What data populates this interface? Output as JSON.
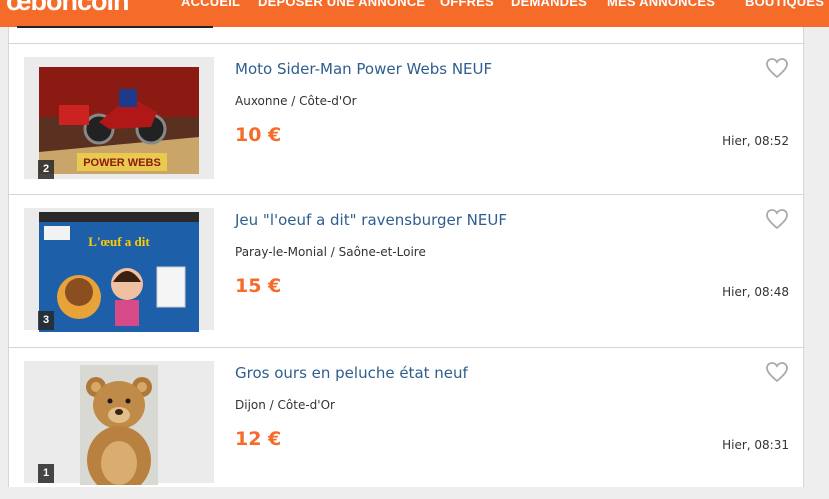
{
  "header": {
    "logo": "œboncoin",
    "nav": [
      "ACCUEIL",
      "DÉPOSER UNE ANNONCE",
      "OFFRES",
      "DEMANDES",
      "MES ANNONCES",
      "BOUTIQUES"
    ]
  },
  "colors": {
    "brand": "#f56b2a",
    "title_link": "#2e5e8e"
  },
  "listings": [
    {
      "title": "Moto Sider-Man Power Webs NEUF",
      "location": "Auxonne / Côte-d'Or",
      "price": "10 €",
      "date": "Hier, 08:52",
      "photo_count": "2",
      "photo_text": "POWER WEBS",
      "favorite_icon": "heart-outline-icon"
    },
    {
      "title": "Jeu \"l'oeuf a dit\" ravensburger NEUF",
      "location": "Paray-le-Monial / Saône-et-Loire",
      "price": "15 €",
      "date": "Hier, 08:48",
      "photo_count": "3",
      "photo_text": "L'œuf a dit",
      "favorite_icon": "heart-outline-icon"
    },
    {
      "title": "Gros ours en peluche état neuf",
      "location": "Dijon / Côte-d'Or",
      "price": "12 €",
      "date": "Hier, 08:31",
      "photo_count": "1",
      "favorite_icon": "heart-outline-icon"
    }
  ]
}
